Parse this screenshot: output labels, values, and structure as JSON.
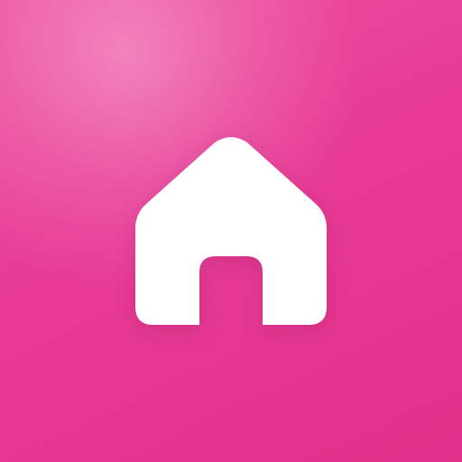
{
  "app_icon": {
    "icon": "home-icon",
    "background_color": "#e73b96",
    "icon_color": "#ffffff"
  }
}
